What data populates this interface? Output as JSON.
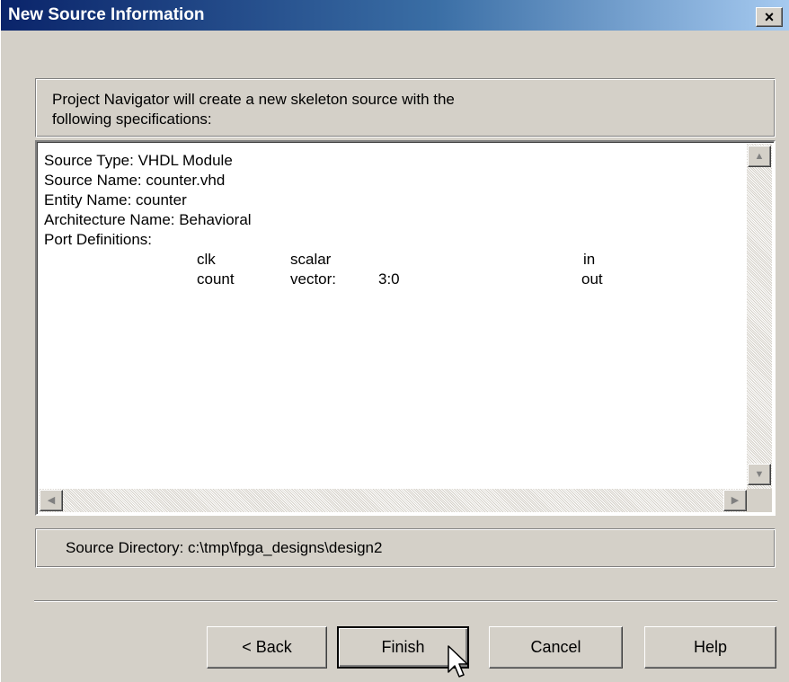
{
  "window": {
    "title": "New Source Information",
    "close_label": "×"
  },
  "intro": {
    "text_line1": "Project Navigator will create a new skeleton source with the",
    "text_line2": "following specifications:"
  },
  "spec": {
    "lines": [
      "Source Type:  VHDL Module",
      "Source Name:  counter.vhd",
      "Entity Name:  counter",
      "Architecture Name:  Behavioral",
      "Port Definitions:"
    ],
    "ports": [
      {
        "name": "clk",
        "type": "scalar",
        "range": "",
        "direction": "in"
      },
      {
        "name": "count",
        "type": "vector:",
        "range": "3:0",
        "direction": "out"
      }
    ]
  },
  "scroll": {
    "up_icon": "▲",
    "down_icon": "▼",
    "left_icon": "◀",
    "right_icon": "▶"
  },
  "source_directory": {
    "text": "Source Directory:  c:\\tmp\\fpga_designs\\design2"
  },
  "buttons": {
    "back": "< Back",
    "finish": "Finish",
    "cancel": "Cancel",
    "help": "Help"
  },
  "colors": {
    "title_start": "#0a246a",
    "title_end": "#a6caf0",
    "face": "#d4d0c8"
  }
}
